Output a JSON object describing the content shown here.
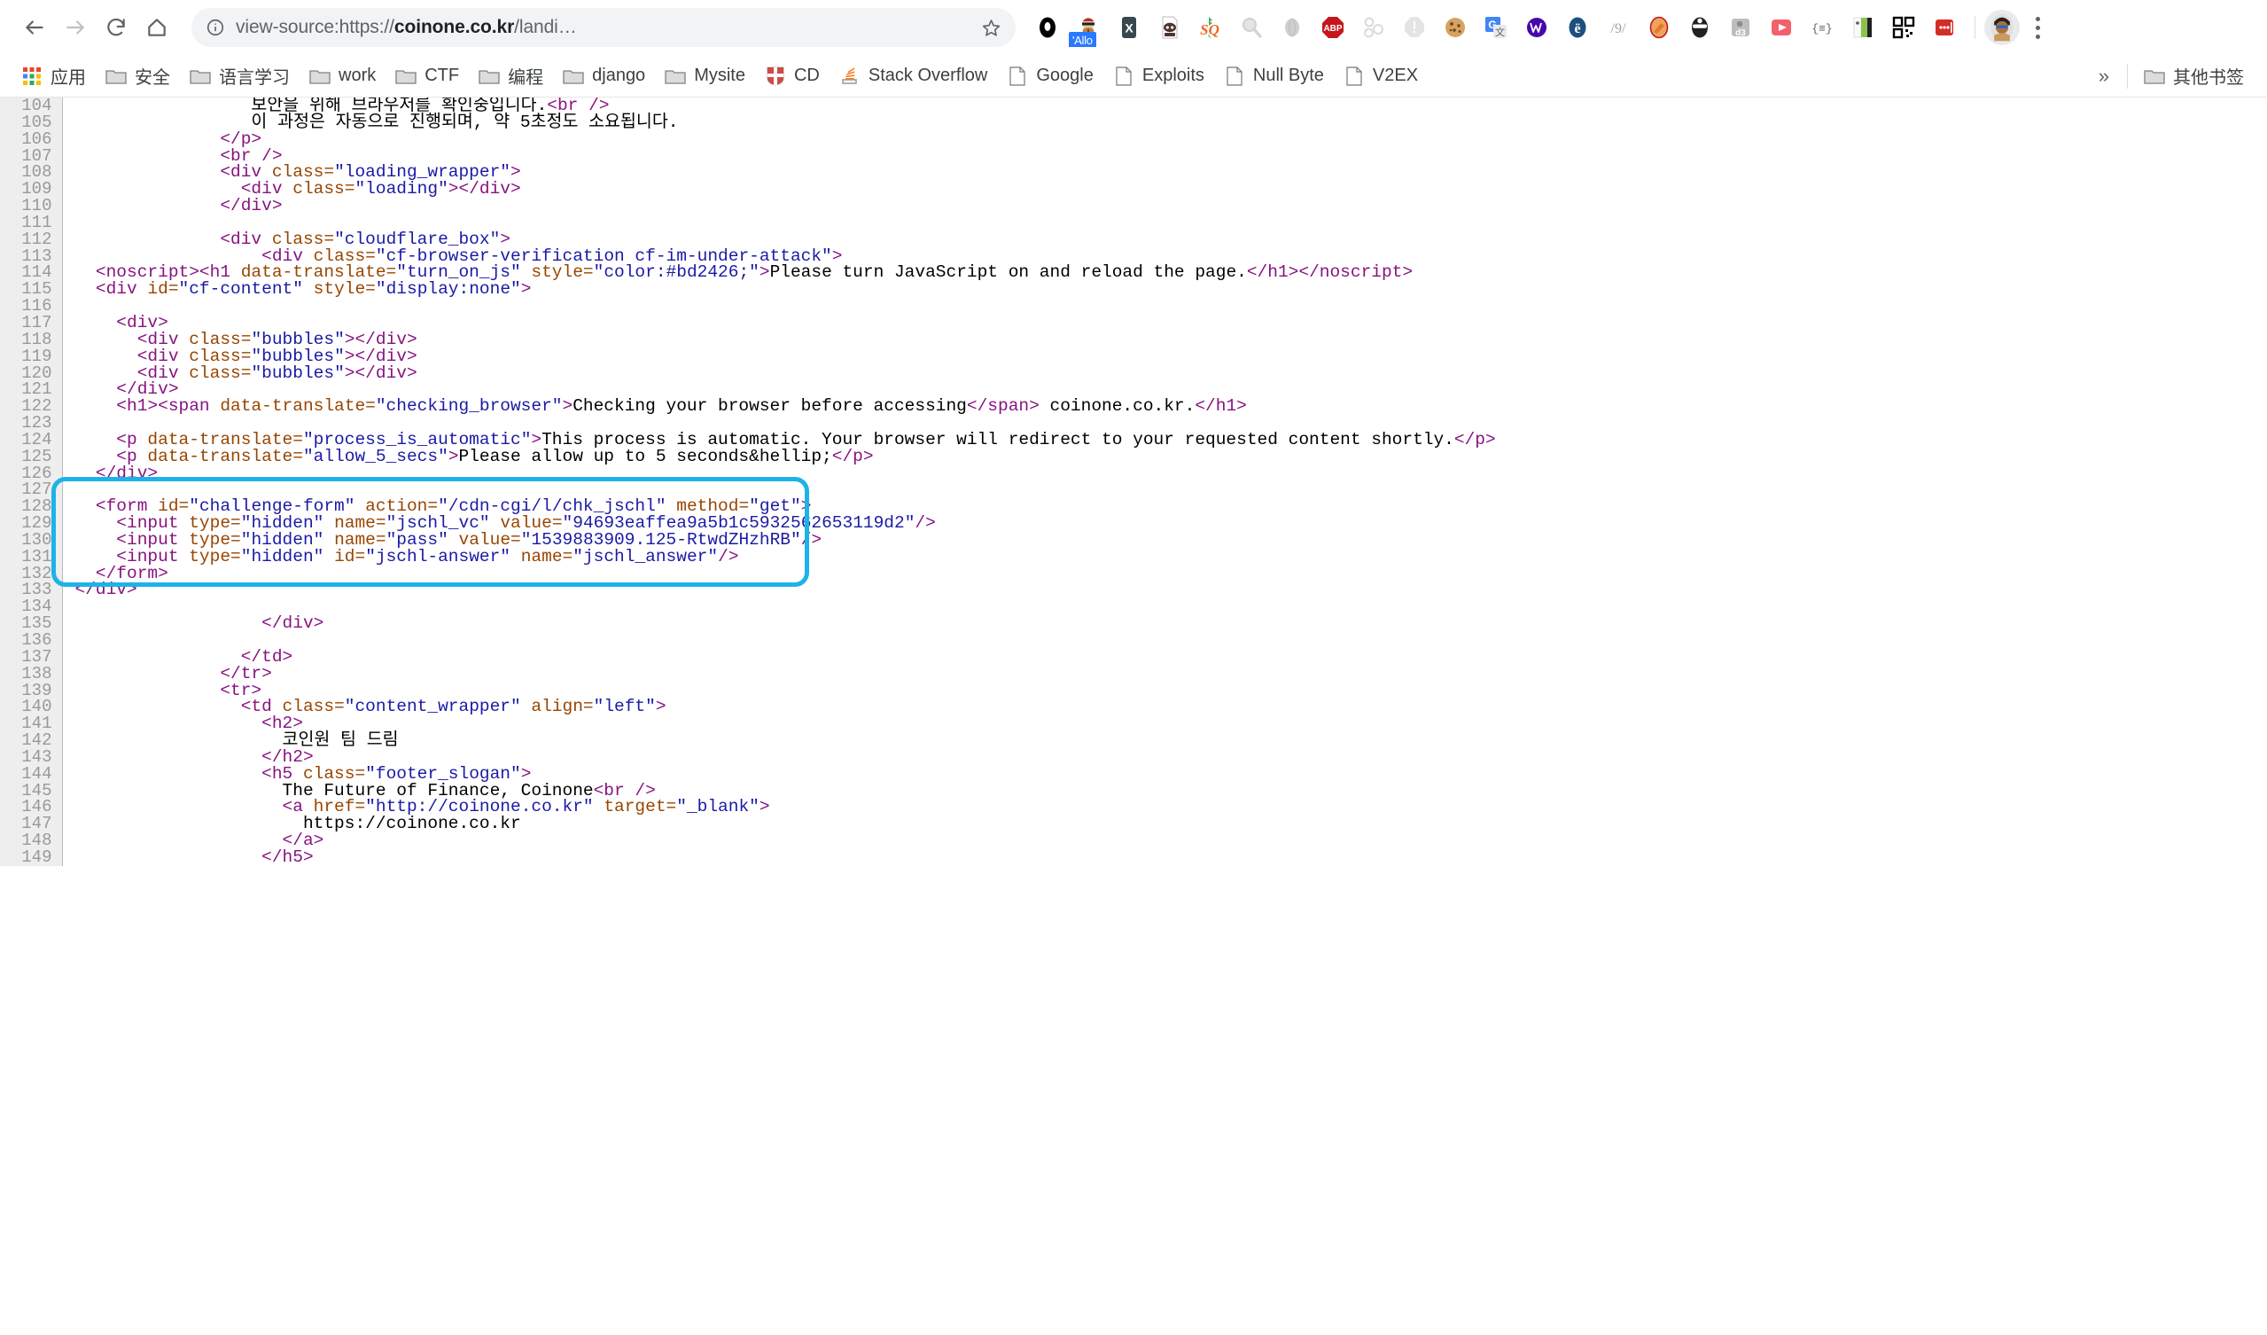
{
  "browser": {
    "nav": {
      "back_label": "Back",
      "forward_label": "Forward",
      "reload_label": "Reload",
      "home_label": "Home"
    },
    "omnibox": {
      "scheme_prefix": "view-source:https://",
      "host": "coinone.co.kr",
      "path_truncated": "/landi…",
      "full_display": "view-source:https://coinone.co.kr/landi…",
      "info_icon": "info-circle-icon",
      "star_icon": "star-icon"
    },
    "extensions": [
      {
        "name": "ghostery-icon",
        "glyph": "⬤",
        "color": "#000000",
        "badge": ""
      },
      {
        "name": "allo-privacy-badger-icon",
        "glyph": "",
        "color": "#a03a2a",
        "badge": "'Allo"
      },
      {
        "name": "xmarks-icon",
        "glyph": "X",
        "color": "#37474f",
        "badge": ""
      },
      {
        "name": "user-agent-switcher-icon",
        "glyph": "",
        "color": "#5d4037",
        "badge": ""
      },
      {
        "name": "stylish-sq-icon",
        "glyph": "SQ",
        "color": "#f26522",
        "badge": ""
      },
      {
        "name": "magnifier-search-icon",
        "glyph": "",
        "color": "#d0d0d0",
        "badge": ""
      },
      {
        "name": "globe-icon",
        "glyph": "",
        "color": "#c8c8c8",
        "badge": ""
      },
      {
        "name": "adblock-plus-icon",
        "glyph": "ABP",
        "color": "#c4161c",
        "badge": ""
      },
      {
        "name": "molecule-proxy-icon",
        "glyph": "",
        "color": "#d8d8d8",
        "badge": ""
      },
      {
        "name": "alert-octagon-icon",
        "glyph": "!",
        "color": "#dcdcdc",
        "badge": ""
      },
      {
        "name": "cookie-manager-icon",
        "glyph": "",
        "color": "#c68a3e",
        "badge": ""
      },
      {
        "name": "google-translate-icon",
        "glyph": "G",
        "color": "#4285f4",
        "badge": ""
      },
      {
        "name": "wappalyzer-icon",
        "glyph": "",
        "color": "#4608ad",
        "badge": ""
      },
      {
        "name": "edit-this-cookie-icon",
        "glyph": "e",
        "color": "#1c4f7c",
        "badge": ""
      },
      {
        "name": "fork-knife-icon",
        "glyph": "/9/",
        "color": "#9aa0a6",
        "badge": ""
      },
      {
        "name": "hammer-build-icon",
        "glyph": "",
        "color": "#e8763a",
        "badge": ""
      },
      {
        "name": "incognito-mask-icon",
        "glyph": "",
        "color": "#202124",
        "badge": ""
      },
      {
        "name": "d3-coach-icon",
        "glyph": "d3",
        "color": "#9e9e9e",
        "badge": ""
      },
      {
        "name": "video-downloader-icon",
        "glyph": "▶",
        "color": "#f4606c",
        "badge": ""
      },
      {
        "name": "json-viewer-icon",
        "glyph": "{≡}",
        "color": "#5f6368",
        "badge": ""
      },
      {
        "name": "tab-manager-icon",
        "glyph": "",
        "color": "#8bc34a",
        "badge": ""
      },
      {
        "name": "qr-code-icon",
        "glyph": "",
        "color": "#000000",
        "badge": ""
      },
      {
        "name": "lastpass-icon",
        "glyph": "•••",
        "color": "#d32d27",
        "badge": ""
      }
    ],
    "profile": {
      "name": "profile-avatar",
      "label": ""
    },
    "menu": {
      "name": "chrome-menu-button",
      "label": "⋮"
    }
  },
  "bookmarks": {
    "items": [
      {
        "label": "应用",
        "icon": "apps-grid-icon"
      },
      {
        "label": "安全",
        "icon": "folder-icon"
      },
      {
        "label": "语言学习",
        "icon": "folder-icon"
      },
      {
        "label": "work",
        "icon": "folder-icon"
      },
      {
        "label": "CTF",
        "icon": "folder-icon"
      },
      {
        "label": "编程",
        "icon": "folder-icon"
      },
      {
        "label": "django",
        "icon": "folder-icon"
      },
      {
        "label": "Mysite",
        "icon": "folder-icon"
      },
      {
        "label": "CD",
        "icon": "shield-crest-icon"
      },
      {
        "label": "Stack Overflow",
        "icon": "stack-overflow-icon"
      },
      {
        "label": "Google",
        "icon": "page-icon"
      },
      {
        "label": "Exploits",
        "icon": "page-icon"
      },
      {
        "label": "Null Byte",
        "icon": "page-icon"
      },
      {
        "label": "V2EX",
        "icon": "page-icon"
      }
    ],
    "overflow_label": "»",
    "other_bookmarks": {
      "label": "其他书签",
      "icon": "folder-icon"
    }
  },
  "source_view": {
    "first_line": 104,
    "last_line": 149,
    "highlight": {
      "from_line": 127,
      "to_line": 132,
      "color": "#1eb3e8",
      "description": "cyan rounded-rectangle annotation around the challenge-form block"
    },
    "lines": [
      {
        "n": 104,
        "segments": [
          {
            "t": "tx",
            "v": "                 보안을 위해 브라우저를 확인중입니다."
          },
          {
            "t": "tg",
            "v": "<br />"
          }
        ]
      },
      {
        "n": 105,
        "segments": [
          {
            "t": "tx",
            "v": "                 이 과정은 자동으로 진행되며, 약 5초정도 소요됩니다."
          }
        ]
      },
      {
        "n": 106,
        "segments": [
          {
            "t": "tg",
            "v": "              </p>"
          }
        ]
      },
      {
        "n": 107,
        "segments": [
          {
            "t": "tg",
            "v": "              <br />"
          }
        ]
      },
      {
        "n": 108,
        "segments": [
          {
            "t": "tg",
            "v": "              <div "
          },
          {
            "t": "at",
            "v": "class="
          },
          {
            "t": "av",
            "v": "\"loading_wrapper\""
          },
          {
            "t": "tg",
            "v": ">"
          }
        ]
      },
      {
        "n": 109,
        "segments": [
          {
            "t": "tg",
            "v": "                <div "
          },
          {
            "t": "at",
            "v": "class="
          },
          {
            "t": "av",
            "v": "\"loading\""
          },
          {
            "t": "tg",
            "v": "></div>"
          }
        ]
      },
      {
        "n": 110,
        "segments": [
          {
            "t": "tg",
            "v": "              </div>"
          }
        ]
      },
      {
        "n": 111,
        "segments": [
          {
            "t": "tx",
            "v": ""
          }
        ]
      },
      {
        "n": 112,
        "segments": [
          {
            "t": "tg",
            "v": "              <div "
          },
          {
            "t": "at",
            "v": "class="
          },
          {
            "t": "av",
            "v": "\"cloudflare_box\""
          },
          {
            "t": "tg",
            "v": ">"
          }
        ]
      },
      {
        "n": 113,
        "segments": [
          {
            "t": "tg",
            "v": "                  <div "
          },
          {
            "t": "at",
            "v": "class="
          },
          {
            "t": "av",
            "v": "\"cf-browser-verification cf-im-under-attack\""
          },
          {
            "t": "tg",
            "v": ">"
          }
        ]
      },
      {
        "n": 114,
        "segments": [
          {
            "t": "tg",
            "v": "  <noscript><h1 "
          },
          {
            "t": "at",
            "v": "data-translate="
          },
          {
            "t": "av",
            "v": "\"turn_on_js\""
          },
          {
            "t": "at",
            "v": " style="
          },
          {
            "t": "av",
            "v": "\"color:#bd2426;\""
          },
          {
            "t": "tg",
            "v": ">"
          },
          {
            "t": "tx",
            "v": "Please turn JavaScript on and reload the page."
          },
          {
            "t": "tg",
            "v": "</h1></noscript>"
          }
        ]
      },
      {
        "n": 115,
        "segments": [
          {
            "t": "tg",
            "v": "  <div "
          },
          {
            "t": "at",
            "v": "id="
          },
          {
            "t": "av",
            "v": "\"cf-content\""
          },
          {
            "t": "at",
            "v": " style="
          },
          {
            "t": "av",
            "v": "\"display:none\""
          },
          {
            "t": "tg",
            "v": ">"
          }
        ]
      },
      {
        "n": 116,
        "segments": [
          {
            "t": "tx",
            "v": ""
          }
        ]
      },
      {
        "n": 117,
        "segments": [
          {
            "t": "tg",
            "v": "    <div>"
          }
        ]
      },
      {
        "n": 118,
        "segments": [
          {
            "t": "tg",
            "v": "      <div "
          },
          {
            "t": "at",
            "v": "class="
          },
          {
            "t": "av",
            "v": "\"bubbles\""
          },
          {
            "t": "tg",
            "v": "></div>"
          }
        ]
      },
      {
        "n": 119,
        "segments": [
          {
            "t": "tg",
            "v": "      <div "
          },
          {
            "t": "at",
            "v": "class="
          },
          {
            "t": "av",
            "v": "\"bubbles\""
          },
          {
            "t": "tg",
            "v": "></div>"
          }
        ]
      },
      {
        "n": 120,
        "segments": [
          {
            "t": "tg",
            "v": "      <div "
          },
          {
            "t": "at",
            "v": "class="
          },
          {
            "t": "av",
            "v": "\"bubbles\""
          },
          {
            "t": "tg",
            "v": "></div>"
          }
        ]
      },
      {
        "n": 121,
        "segments": [
          {
            "t": "tg",
            "v": "    </div>"
          }
        ]
      },
      {
        "n": 122,
        "segments": [
          {
            "t": "tg",
            "v": "    <h1><span "
          },
          {
            "t": "at",
            "v": "data-translate="
          },
          {
            "t": "av",
            "v": "\"checking_browser\""
          },
          {
            "t": "tg",
            "v": ">"
          },
          {
            "t": "tx",
            "v": "Checking your browser before accessing"
          },
          {
            "t": "tg",
            "v": "</span>"
          },
          {
            "t": "tx",
            "v": " coinone.co.kr."
          },
          {
            "t": "tg",
            "v": "</h1>"
          }
        ]
      },
      {
        "n": 123,
        "segments": [
          {
            "t": "tx",
            "v": ""
          }
        ]
      },
      {
        "n": 124,
        "segments": [
          {
            "t": "tg",
            "v": "    <p "
          },
          {
            "t": "at",
            "v": "data-translate="
          },
          {
            "t": "av",
            "v": "\"process_is_automatic\""
          },
          {
            "t": "tg",
            "v": ">"
          },
          {
            "t": "tx",
            "v": "This process is automatic. Your browser will redirect to your requested content shortly."
          },
          {
            "t": "tg",
            "v": "</p>"
          }
        ]
      },
      {
        "n": 125,
        "segments": [
          {
            "t": "tg",
            "v": "    <p "
          },
          {
            "t": "at",
            "v": "data-translate="
          },
          {
            "t": "av",
            "v": "\"allow_5_secs\""
          },
          {
            "t": "tg",
            "v": ">"
          },
          {
            "t": "tx",
            "v": "Please allow up to 5 seconds&hellip;"
          },
          {
            "t": "tg",
            "v": "</p>"
          }
        ]
      },
      {
        "n": 126,
        "segments": [
          {
            "t": "tg",
            "v": "  </div>"
          }
        ]
      },
      {
        "n": 127,
        "segments": [
          {
            "t": "tx",
            "v": ""
          }
        ]
      },
      {
        "n": 128,
        "segments": [
          {
            "t": "tg",
            "v": "  <form "
          },
          {
            "t": "at",
            "v": "id="
          },
          {
            "t": "av",
            "v": "\"challenge-form\""
          },
          {
            "t": "at",
            "v": " action="
          },
          {
            "t": "av",
            "v": "\"/cdn-cgi/l/chk_jschl\""
          },
          {
            "t": "at",
            "v": " method="
          },
          {
            "t": "av",
            "v": "\"get\""
          },
          {
            "t": "tg",
            "v": ">"
          }
        ]
      },
      {
        "n": 129,
        "segments": [
          {
            "t": "tg",
            "v": "    <input "
          },
          {
            "t": "at",
            "v": "type="
          },
          {
            "t": "av",
            "v": "\"hidden\""
          },
          {
            "t": "at",
            "v": " name="
          },
          {
            "t": "av",
            "v": "\"jschl_vc\""
          },
          {
            "t": "at",
            "v": " value="
          },
          {
            "t": "av",
            "v": "\"94693eaffea9a5b1c5932562653119d2\""
          },
          {
            "t": "tg",
            "v": "/>"
          }
        ]
      },
      {
        "n": 130,
        "segments": [
          {
            "t": "tg",
            "v": "    <input "
          },
          {
            "t": "at",
            "v": "type="
          },
          {
            "t": "av",
            "v": "\"hidden\""
          },
          {
            "t": "at",
            "v": " name="
          },
          {
            "t": "av",
            "v": "\"pass\""
          },
          {
            "t": "at",
            "v": " value="
          },
          {
            "t": "av",
            "v": "\"1539883909.125-RtwdZHzhRB\""
          },
          {
            "t": "tg",
            "v": "/>"
          }
        ]
      },
      {
        "n": 131,
        "segments": [
          {
            "t": "tg",
            "v": "    <input "
          },
          {
            "t": "at",
            "v": "type="
          },
          {
            "t": "av",
            "v": "\"hidden\""
          },
          {
            "t": "at",
            "v": " id="
          },
          {
            "t": "av",
            "v": "\"jschl-answer\""
          },
          {
            "t": "at",
            "v": " name="
          },
          {
            "t": "av",
            "v": "\"jschl_answer\""
          },
          {
            "t": "tg",
            "v": "/>"
          }
        ]
      },
      {
        "n": 132,
        "segments": [
          {
            "t": "tg",
            "v": "  </form>"
          }
        ]
      },
      {
        "n": 133,
        "segments": [
          {
            "t": "tg",
            "v": "</div>"
          }
        ]
      },
      {
        "n": 134,
        "segments": [
          {
            "t": "tx",
            "v": ""
          }
        ]
      },
      {
        "n": 135,
        "segments": [
          {
            "t": "tg",
            "v": "                  </div>"
          }
        ]
      },
      {
        "n": 136,
        "segments": [
          {
            "t": "tx",
            "v": ""
          }
        ]
      },
      {
        "n": 137,
        "segments": [
          {
            "t": "tg",
            "v": "                </td>"
          }
        ]
      },
      {
        "n": 138,
        "segments": [
          {
            "t": "tg",
            "v": "              </tr>"
          }
        ]
      },
      {
        "n": 139,
        "segments": [
          {
            "t": "tg",
            "v": "              <tr>"
          }
        ]
      },
      {
        "n": 140,
        "segments": [
          {
            "t": "tg",
            "v": "                <td "
          },
          {
            "t": "at",
            "v": "class="
          },
          {
            "t": "av",
            "v": "\"content_wrapper\""
          },
          {
            "t": "at",
            "v": " align="
          },
          {
            "t": "av",
            "v": "\"left\""
          },
          {
            "t": "tg",
            "v": ">"
          }
        ]
      },
      {
        "n": 141,
        "segments": [
          {
            "t": "tg",
            "v": "                  <h2>"
          }
        ]
      },
      {
        "n": 142,
        "segments": [
          {
            "t": "tx",
            "v": "                    코인원 팀 드림"
          }
        ]
      },
      {
        "n": 143,
        "segments": [
          {
            "t": "tg",
            "v": "                  </h2>"
          }
        ]
      },
      {
        "n": 144,
        "segments": [
          {
            "t": "tg",
            "v": "                  <h5 "
          },
          {
            "t": "at",
            "v": "class="
          },
          {
            "t": "av",
            "v": "\"footer_slogan\""
          },
          {
            "t": "tg",
            "v": ">"
          }
        ]
      },
      {
        "n": 145,
        "segments": [
          {
            "t": "tx",
            "v": "                    The Future of Finance, Coinone"
          },
          {
            "t": "tg",
            "v": "<br />"
          }
        ]
      },
      {
        "n": 146,
        "segments": [
          {
            "t": "tg",
            "v": "                    <a "
          },
          {
            "t": "at",
            "v": "href="
          },
          {
            "t": "av",
            "v": "\"http://coinone.co.kr\""
          },
          {
            "t": "at",
            "v": " target="
          },
          {
            "t": "av",
            "v": "\"_blank\""
          },
          {
            "t": "tg",
            "v": ">"
          }
        ]
      },
      {
        "n": 147,
        "segments": [
          {
            "t": "tx",
            "v": "                      https://coinone.co.kr"
          }
        ]
      },
      {
        "n": 148,
        "segments": [
          {
            "t": "tg",
            "v": "                    </a>"
          }
        ]
      },
      {
        "n": 149,
        "segments": [
          {
            "t": "tg",
            "v": "                  </h5>"
          }
        ]
      }
    ]
  }
}
